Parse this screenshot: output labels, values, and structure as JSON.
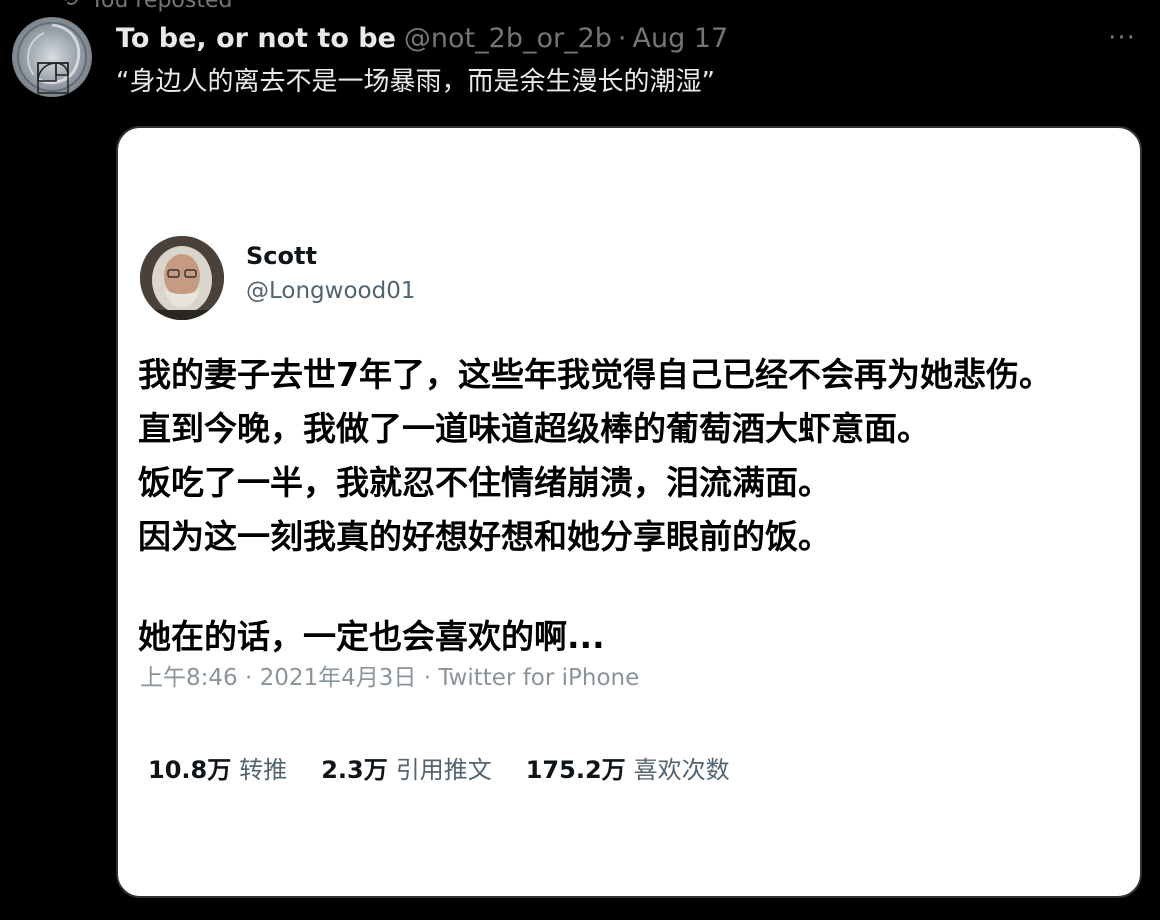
{
  "repost_banner": {
    "text": "You reposted"
  },
  "tweet": {
    "display_name": "To be, or not to be",
    "handle": "@not_2b_or_2b",
    "separator": "·",
    "date": "Aug 17",
    "more_icon": "more-horizontal-icon",
    "text": "“身边人的离去不是一场暴雨，而是余生漫长的潮湿”"
  },
  "embedded": {
    "name": "Scott",
    "handle": "@Longwood01",
    "lines": [
      "我的妻子去世7年了，这些年我觉得自己已经不会再为她悲伤。",
      "直到今晚，我做了一道味道超级棒的葡萄酒大虾意面。",
      "饭吃了一半，我就忍不住情绪崩溃，泪流满面。",
      "因为这一刻我真的好想好想和她分享眼前的饭。"
    ],
    "closing": "她在的话，一定也会喜欢的啊...",
    "meta": "上午8:46 · 2021年4月3日 · Twitter for iPhone",
    "stats": [
      {
        "value": "10.8万",
        "label": "转推"
      },
      {
        "value": "2.3万",
        "label": "引用推文"
      },
      {
        "value": "175.2万",
        "label": "喜欢次数"
      }
    ]
  },
  "colors": {
    "background": "#000000",
    "primary_text": "#e7e9ea",
    "secondary_text": "#71767b",
    "card_background": "#ffffff"
  }
}
